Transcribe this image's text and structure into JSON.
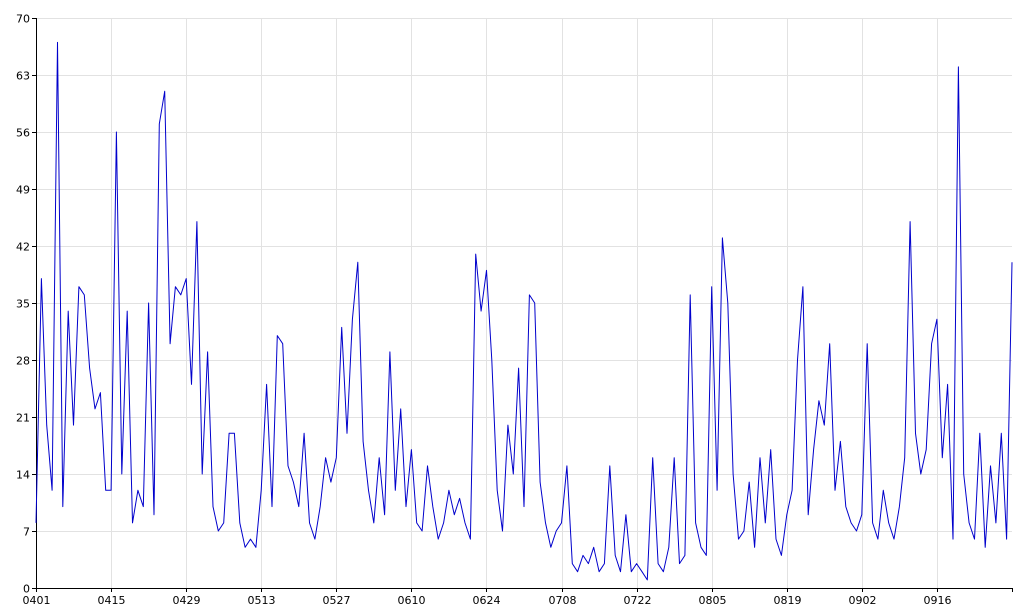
{
  "chart_data": {
    "type": "line",
    "title": "",
    "xlabel": "",
    "ylabel": "",
    "ylim": [
      0,
      70
    ],
    "yticks": [
      0,
      7,
      14,
      21,
      28,
      35,
      42,
      49,
      56,
      63,
      70
    ],
    "xticks": [
      "0401",
      "0415",
      "0429",
      "0513",
      "0527",
      "0610",
      "0624",
      "0708",
      "0722",
      "0805",
      "0819",
      "0902",
      "0916"
    ],
    "x_range": [
      "0401",
      "0930"
    ],
    "grid": true,
    "line_color": "#0000cc",
    "series": [
      {
        "name": "",
        "points": [
          [
            "0401",
            8
          ],
          [
            "0402",
            38
          ],
          [
            "0403",
            20
          ],
          [
            "0404",
            12
          ],
          [
            "0405",
            67
          ],
          [
            "0406",
            10
          ],
          [
            "0407",
            34
          ],
          [
            "0408",
            20
          ],
          [
            "0409",
            37
          ],
          [
            "0410",
            36
          ],
          [
            "0411",
            27
          ],
          [
            "0412",
            22
          ],
          [
            "0413",
            24
          ],
          [
            "0414",
            12
          ],
          [
            "0415",
            12
          ],
          [
            "0416",
            56
          ],
          [
            "0417",
            14
          ],
          [
            "0418",
            34
          ],
          [
            "0419",
            8
          ],
          [
            "0420",
            12
          ],
          [
            "0421",
            10
          ],
          [
            "0422",
            35
          ],
          [
            "0423",
            9
          ],
          [
            "0424",
            57
          ],
          [
            "0425",
            61
          ],
          [
            "0426",
            30
          ],
          [
            "0427",
            37
          ],
          [
            "0428",
            36
          ],
          [
            "0429",
            38
          ],
          [
            "0430",
            25
          ],
          [
            "0501",
            45
          ],
          [
            "0502",
            14
          ],
          [
            "0503",
            29
          ],
          [
            "0504",
            10
          ],
          [
            "0505",
            7
          ],
          [
            "0506",
            8
          ],
          [
            "0507",
            19
          ],
          [
            "0508",
            19
          ],
          [
            "0509",
            8
          ],
          [
            "0510",
            5
          ],
          [
            "0511",
            6
          ],
          [
            "0512",
            5
          ],
          [
            "0513",
            12
          ],
          [
            "0514",
            25
          ],
          [
            "0515",
            10
          ],
          [
            "0516",
            31
          ],
          [
            "0517",
            30
          ],
          [
            "0518",
            15
          ],
          [
            "0519",
            13
          ],
          [
            "0520",
            10
          ],
          [
            "0521",
            19
          ],
          [
            "0522",
            8
          ],
          [
            "0523",
            6
          ],
          [
            "0524",
            10
          ],
          [
            "0525",
            16
          ],
          [
            "0526",
            13
          ],
          [
            "0527",
            16
          ],
          [
            "0528",
            32
          ],
          [
            "0529",
            19
          ],
          [
            "0530",
            33
          ],
          [
            "0531",
            40
          ],
          [
            "0601",
            18
          ],
          [
            "0602",
            12
          ],
          [
            "0603",
            8
          ],
          [
            "0604",
            16
          ],
          [
            "0605",
            9
          ],
          [
            "0606",
            29
          ],
          [
            "0607",
            12
          ],
          [
            "0608",
            22
          ],
          [
            "0609",
            10
          ],
          [
            "0610",
            17
          ],
          [
            "0611",
            8
          ],
          [
            "0612",
            7
          ],
          [
            "0613",
            15
          ],
          [
            "0614",
            10
          ],
          [
            "0615",
            6
          ],
          [
            "0616",
            8
          ],
          [
            "0617",
            12
          ],
          [
            "0618",
            9
          ],
          [
            "0619",
            11
          ],
          [
            "0620",
            8
          ],
          [
            "0621",
            6
          ],
          [
            "0622",
            41
          ],
          [
            "0623",
            34
          ],
          [
            "0624",
            39
          ],
          [
            "0625",
            28
          ],
          [
            "0626",
            12
          ],
          [
            "0627",
            7
          ],
          [
            "0628",
            20
          ],
          [
            "0629",
            14
          ],
          [
            "0630",
            27
          ],
          [
            "0701",
            10
          ],
          [
            "0702",
            36
          ],
          [
            "0703",
            35
          ],
          [
            "0704",
            13
          ],
          [
            "0705",
            8
          ],
          [
            "0706",
            5
          ],
          [
            "0707",
            7
          ],
          [
            "0708",
            8
          ],
          [
            "0709",
            15
          ],
          [
            "0710",
            3
          ],
          [
            "0711",
            2
          ],
          [
            "0712",
            4
          ],
          [
            "0713",
            3
          ],
          [
            "0714",
            5
          ],
          [
            "0715",
            2
          ],
          [
            "0716",
            3
          ],
          [
            "0717",
            15
          ],
          [
            "0718",
            4
          ],
          [
            "0719",
            2
          ],
          [
            "0720",
            9
          ],
          [
            "0721",
            2
          ],
          [
            "0722",
            3
          ],
          [
            "0723",
            2
          ],
          [
            "0724",
            1
          ],
          [
            "0725",
            16
          ],
          [
            "0726",
            3
          ],
          [
            "0727",
            2
          ],
          [
            "0728",
            5
          ],
          [
            "0729",
            16
          ],
          [
            "0730",
            3
          ],
          [
            "0731",
            4
          ],
          [
            "0801",
            36
          ],
          [
            "0802",
            8
          ],
          [
            "0803",
            5
          ],
          [
            "0804",
            4
          ],
          [
            "0805",
            37
          ],
          [
            "0806",
            12
          ],
          [
            "0807",
            43
          ],
          [
            "0808",
            35
          ],
          [
            "0809",
            14
          ],
          [
            "0810",
            6
          ],
          [
            "0811",
            7
          ],
          [
            "0812",
            13
          ],
          [
            "0813",
            5
          ],
          [
            "0814",
            16
          ],
          [
            "0815",
            8
          ],
          [
            "0816",
            17
          ],
          [
            "0817",
            6
          ],
          [
            "0818",
            4
          ],
          [
            "0819",
            9
          ],
          [
            "0820",
            12
          ],
          [
            "0821",
            28
          ],
          [
            "0822",
            37
          ],
          [
            "0823",
            9
          ],
          [
            "0824",
            17
          ],
          [
            "0825",
            23
          ],
          [
            "0826",
            20
          ],
          [
            "0827",
            30
          ],
          [
            "0828",
            12
          ],
          [
            "0829",
            18
          ],
          [
            "0830",
            10
          ],
          [
            "0831",
            8
          ],
          [
            "0901",
            7
          ],
          [
            "0902",
            9
          ],
          [
            "0903",
            30
          ],
          [
            "0904",
            8
          ],
          [
            "0905",
            6
          ],
          [
            "0906",
            12
          ],
          [
            "0907",
            8
          ],
          [
            "0908",
            6
          ],
          [
            "0909",
            10
          ],
          [
            "0910",
            16
          ],
          [
            "0911",
            45
          ],
          [
            "0912",
            19
          ],
          [
            "0913",
            14
          ],
          [
            "0914",
            17
          ],
          [
            "0915",
            30
          ],
          [
            "0916",
            33
          ],
          [
            "0917",
            16
          ],
          [
            "0918",
            25
          ],
          [
            "0919",
            6
          ],
          [
            "0920",
            64
          ],
          [
            "0921",
            14
          ],
          [
            "0922",
            8
          ],
          [
            "0923",
            6
          ],
          [
            "0924",
            19
          ],
          [
            "0925",
            5
          ],
          [
            "0926",
            15
          ],
          [
            "0927",
            8
          ],
          [
            "0928",
            19
          ],
          [
            "0929",
            6
          ],
          [
            "0930",
            40
          ]
        ]
      }
    ]
  }
}
